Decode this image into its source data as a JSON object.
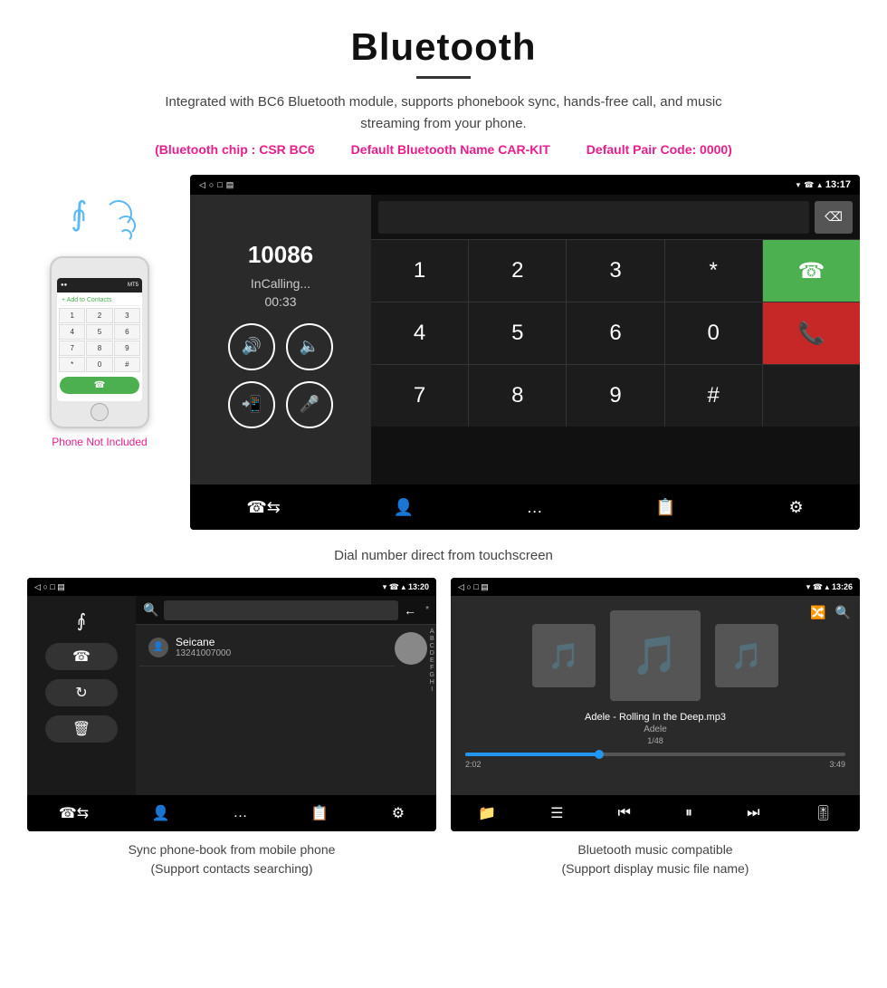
{
  "page": {
    "title": "Bluetooth",
    "subtitle": "Integrated with BC6 Bluetooth module, supports phonebook sync, hands-free call, and music streaming from your phone.",
    "specs": {
      "chip": "(Bluetooth chip : CSR BC6",
      "name": "Default Bluetooth Name CAR-KIT",
      "code": "Default Pair Code: 0000)"
    },
    "dial_screen": {
      "status_time": "13:17",
      "number": "10086",
      "call_status": "InCalling...",
      "timer": "00:33",
      "keys": [
        "1",
        "2",
        "3",
        "*",
        "4",
        "5",
        "6",
        "0",
        "7",
        "8",
        "9",
        "#"
      ],
      "green_icon": "📞",
      "red_icon": "📵"
    },
    "dial_caption": "Dial number direct from touchscreen",
    "phonebook_screen": {
      "status_time": "13:20",
      "contact_name": "Seicane",
      "contact_number": "13241007000",
      "alpha": [
        "A",
        "B",
        "C",
        "D",
        "E",
        "F",
        "G",
        "H",
        "I"
      ]
    },
    "phonebook_caption_line1": "Sync phone-book from mobile phone",
    "phonebook_caption_line2": "(Support contacts searching)",
    "music_screen": {
      "status_time": "13:26",
      "song_title": "Adele - Rolling In the Deep.mp3",
      "artist": "Adele",
      "track_info": "1/48",
      "time_current": "2:02",
      "time_total": "3:49"
    },
    "music_caption_line1": "Bluetooth music compatible",
    "music_caption_line2": "(Support display music file name)",
    "phone_label": "Phone Not Included"
  }
}
